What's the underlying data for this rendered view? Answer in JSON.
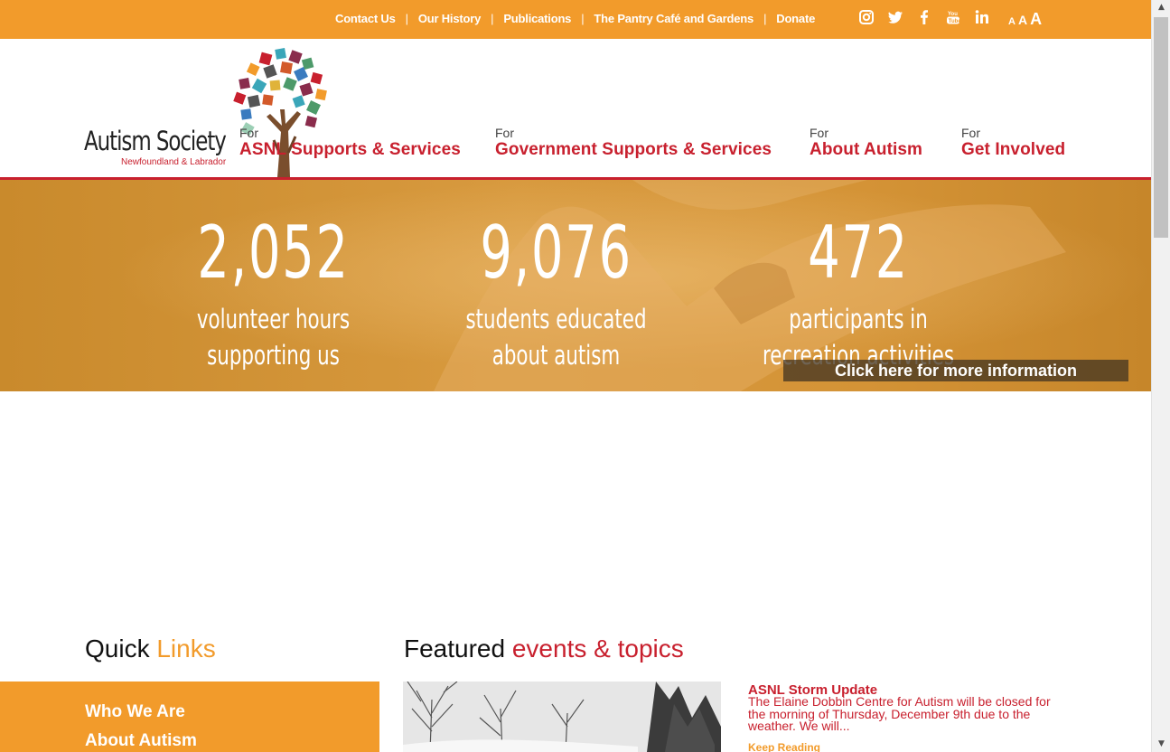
{
  "topbar": {
    "links": [
      "Contact Us",
      "Our History",
      "Publications",
      "The Pantry Café and Gardens",
      "Donate"
    ],
    "separator": "|",
    "social_icons": [
      "instagram-icon",
      "twitter-icon",
      "facebook-icon",
      "youtube-icon",
      "linkedin-icon"
    ],
    "font_size_controls": [
      "A",
      "A",
      "A"
    ]
  },
  "header": {
    "logo_title": "Autism Society",
    "logo_subtitle": "Newfoundland & Labrador",
    "nav": [
      {
        "prefix": "For",
        "label": "ASNL Supports & Services"
      },
      {
        "prefix": "For",
        "label": "Government Supports & Services"
      },
      {
        "prefix": "For",
        "label": "About Autism"
      },
      {
        "prefix": "For",
        "label": "Get Involved"
      }
    ]
  },
  "hero": {
    "stats": [
      {
        "number": "2,052",
        "caption_line1": "volunteer hours",
        "caption_line2": "supporting us"
      },
      {
        "number": "9,076",
        "caption_line1": "students educated",
        "caption_line2": "about autism"
      },
      {
        "number": "472",
        "caption_line1": "participants in",
        "caption_line2": "recreation activities"
      }
    ],
    "cta": "Click here for more information"
  },
  "quick_links": {
    "heading_part1": "Quick",
    "heading_part2": "Links",
    "items": [
      "Who We Are",
      "About Autism"
    ]
  },
  "featured": {
    "heading_part1": "Featured",
    "heading_part2": "events & topics",
    "title": "ASNL Storm Update",
    "excerpt": "The Elaine Dobbin Centre for Autism will be closed for the morning of Thursday, December 9th due to the weather. We will...",
    "read_more": "Keep Reading"
  },
  "colors": {
    "orange": "#f29b2b",
    "red": "#c8202e"
  }
}
